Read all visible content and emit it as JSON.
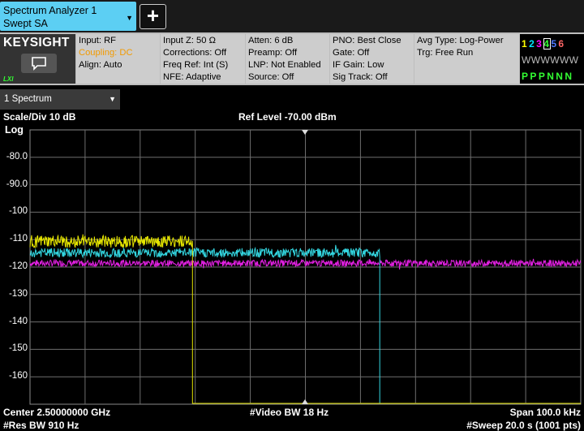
{
  "app": {
    "title_line1": "Spectrum Analyzer 1",
    "title_line2": "Swept SA"
  },
  "logo": "KEYSIGHT",
  "badge": "LXI",
  "settings": [
    [
      "Input: RF",
      "Coupling: DC",
      "Align: Auto"
    ],
    [
      "Input Z: 50 Ω",
      "Corrections: Off",
      "Freq Ref: Int (S)",
      "NFE: Adaptive"
    ],
    [
      "Atten: 6 dB",
      "Preamp: Off",
      "LNP: Not Enabled",
      "Source: Off"
    ],
    [
      "PNO: Best Close",
      "Gate: Off",
      "IF Gain: Low",
      "Sig Track: Off"
    ],
    [
      "Avg Type: Log-Power",
      "Trg: Free Run"
    ]
  ],
  "traces": {
    "numbers": [
      "1",
      "2",
      "3",
      "4",
      "5",
      "6"
    ],
    "number_colors": [
      "#ffff00",
      "#00e5ff",
      "#ff00ff",
      "#33ff33",
      "#4d79ff",
      "#ff6666"
    ],
    "modes": [
      "W",
      "W",
      "W",
      "W",
      "W",
      "W"
    ],
    "detectors": [
      "P",
      "P",
      "P",
      "N",
      "N",
      "N"
    ]
  },
  "window": {
    "tab_label": "1 Spectrum"
  },
  "display": {
    "scale_div": "Scale/Div 10 dB",
    "ref_level": "Ref Level -70.00 dBm",
    "scale_type": "Log",
    "center": "Center 2.50000000 GHz",
    "res_bw": "#Res BW 910 Hz",
    "video_bw": "#Video BW 18 Hz",
    "span": "Span 100.0 kHz",
    "sweep": "#Sweep 20.0 s (1001 pts)"
  },
  "chart_data": {
    "type": "line",
    "y_ticks": [
      "-80.0",
      "-90.0",
      "-100",
      "-110",
      "-120",
      "-130",
      "-140",
      "-150",
      "-160"
    ],
    "ylim": [
      -170,
      -70
    ],
    "xlim": [
      0,
      1000
    ],
    "grid": true,
    "series": [
      {
        "color": "#e6e600",
        "level": -110.7,
        "noise": 2.2,
        "x_end": 295
      },
      {
        "color": "#33d6e0",
        "level": -114.8,
        "noise": 1.7,
        "x_end": 635
      },
      {
        "color": "#e020e0",
        "level": -118.6,
        "noise": 1.2,
        "x_end": 1000
      }
    ]
  }
}
